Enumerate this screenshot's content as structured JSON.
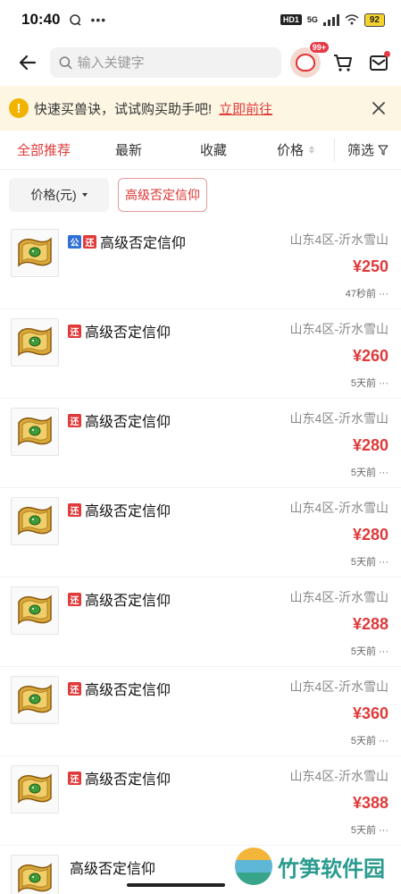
{
  "status_bar": {
    "time": "10:40",
    "dots": "•••",
    "hd_label": "HD1",
    "network": "5G",
    "battery": "92"
  },
  "header": {
    "search_placeholder": "输入关键字",
    "badge": "99+"
  },
  "notice": {
    "text": "快速买兽诀，试试购买助手吧!",
    "link": "立即前往"
  },
  "sort_bar": {
    "all": "全部推荐",
    "newest": "最新",
    "favorites": "收藏",
    "price": "价格",
    "filter": "筛选"
  },
  "chips": {
    "price": "价格(元)",
    "keyword": "高级否定信仰"
  },
  "items": [
    {
      "tags": [
        "公",
        "还"
      ],
      "title": "高级否定信仰",
      "server": "山东4区-沂水雪山",
      "price": "¥250",
      "time": "47秒前 ···"
    },
    {
      "tags": [
        "还"
      ],
      "title": "高级否定信仰",
      "server": "山东4区-沂水雪山",
      "price": "¥260",
      "time": "5天前 ···"
    },
    {
      "tags": [
        "还"
      ],
      "title": "高级否定信仰",
      "server": "山东4区-沂水雪山",
      "price": "¥280",
      "time": "5天前 ···"
    },
    {
      "tags": [
        "还"
      ],
      "title": "高级否定信仰",
      "server": "山东4区-沂水雪山",
      "price": "¥280",
      "time": "5天前 ···"
    },
    {
      "tags": [
        "还"
      ],
      "title": "高级否定信仰",
      "server": "山东4区-沂水雪山",
      "price": "¥288",
      "time": "5天前 ···"
    },
    {
      "tags": [
        "还"
      ],
      "title": "高级否定信仰",
      "server": "山东4区-沂水雪山",
      "price": "¥360",
      "time": "5天前 ···"
    },
    {
      "tags": [
        "还"
      ],
      "title": "高级否定信仰",
      "server": "山东4区-沂水雪山",
      "price": "¥388",
      "time": "5天前 ···"
    },
    {
      "tags": [],
      "title": "高级否定信仰",
      "server": "",
      "price": "",
      "time": ""
    }
  ],
  "watermark": {
    "text": "竹笋软件园"
  },
  "colors": {
    "accent": "#e03a3a",
    "notice_bg": "#fdf6e3",
    "tag_blue": "#2f6fd6"
  }
}
